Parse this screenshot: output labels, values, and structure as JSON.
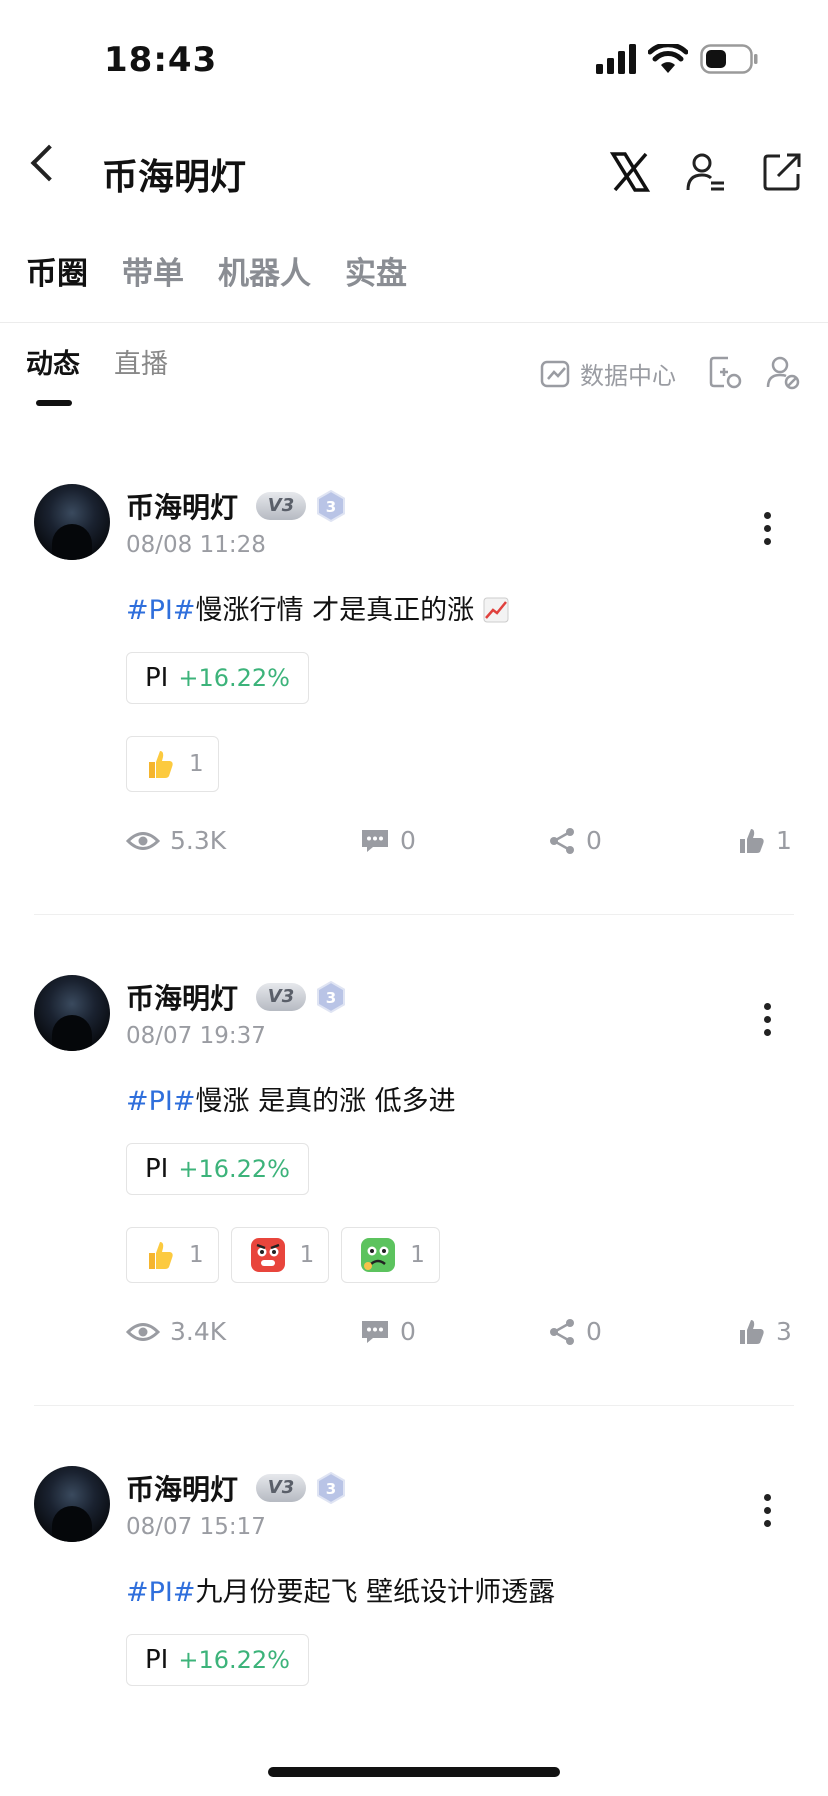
{
  "status_bar": {
    "time": "18:43"
  },
  "header": {
    "title": "币海明灯"
  },
  "tabs": [
    "币圈",
    "带单",
    "机器人",
    "实盘"
  ],
  "subtabs": [
    "动态",
    "直播"
  ],
  "data_center_label": "数据中心",
  "colors": {
    "tag": "#2f6fdc",
    "positive": "#3cb37a",
    "muted": "#9a9ca2"
  },
  "posts": [
    {
      "name": "币海明灯",
      "badge": "V3",
      "level": "3",
      "date": "08/08 11:28",
      "tag": "#PI#",
      "text": "慢涨行情 才是真正的涨",
      "coin": "PI",
      "change": "+16.22%",
      "reactions": [
        {
          "icon": "thumbs-up-emoji",
          "count": "1"
        }
      ],
      "views": "5.3K",
      "comments": "0",
      "shares": "0",
      "likes": "1"
    },
    {
      "name": "币海明灯",
      "badge": "V3",
      "level": "3",
      "date": "08/07 19:37",
      "tag": "#PI#",
      "text": "慢涨 是真的涨 低多进",
      "coin": "PI",
      "change": "+16.22%",
      "reactions": [
        {
          "icon": "thumbs-up-emoji",
          "count": "1"
        },
        {
          "icon": "angry-face-emoji",
          "count": "1"
        },
        {
          "icon": "sick-face-emoji",
          "count": "1"
        }
      ],
      "views": "3.4K",
      "comments": "0",
      "shares": "0",
      "likes": "3"
    },
    {
      "name": "币海明灯",
      "badge": "V3",
      "level": "3",
      "date": "08/07 15:17",
      "tag": "#PI#",
      "text": "九月份要起飞 壁纸设计师透露",
      "coin": "PI",
      "change": "+16.22%"
    }
  ]
}
